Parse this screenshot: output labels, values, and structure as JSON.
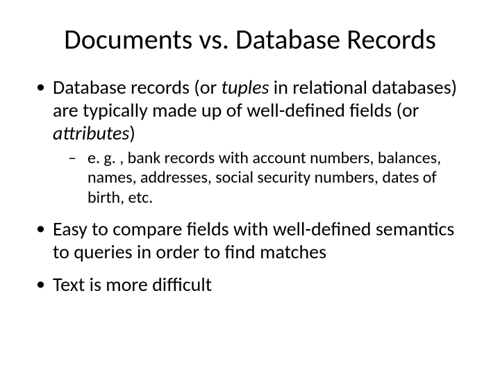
{
  "slide": {
    "title": "Documents vs. Database Records",
    "bullets": {
      "b1_pre": "Database records (or ",
      "b1_it1": "tuples",
      "b1_mid": " in relational databases) are typically made up of well-defined fields (or ",
      "b1_it2": "attributes",
      "b1_post": ")",
      "b1_sub": "e. g. , bank records with account numbers, balances, names, addresses, social security numbers, dates of birth, etc.",
      "b2": "Easy to compare fields with well-defined semantics to queries in order to find matches",
      "b3": "Text is more difficult"
    }
  }
}
